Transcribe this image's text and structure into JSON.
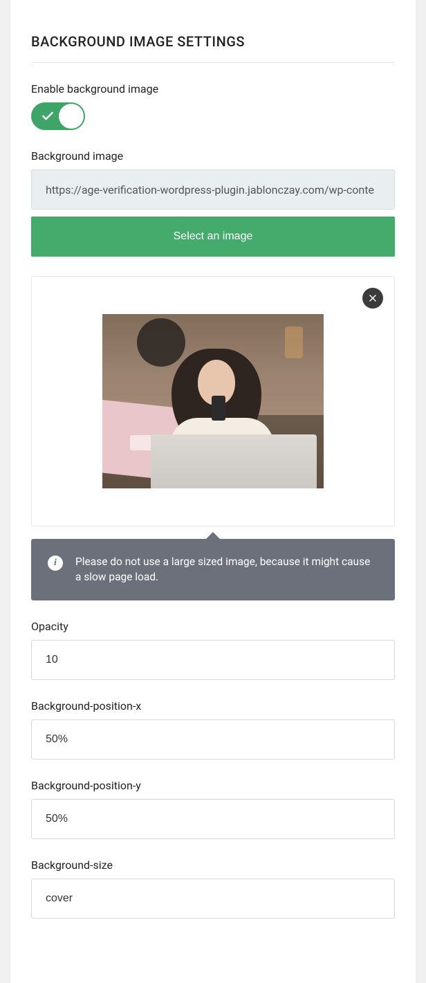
{
  "section_title": "BACKGROUND IMAGE SETTINGS",
  "enable": {
    "label": "Enable background image",
    "on": true
  },
  "bg_image": {
    "label": "Background image",
    "value": "https://age-verification-wordpress-plugin.jablonczay.com/wp-conte",
    "button": "Select an image"
  },
  "tooltip": "Please do not use a large sized image, because it might cause a slow page load.",
  "opacity": {
    "label": "Opacity",
    "value": "10"
  },
  "bpx": {
    "label": "Background-position-x",
    "value": "50%"
  },
  "bpy": {
    "label": "Background-position-y",
    "value": "50%"
  },
  "bsize": {
    "label": "Background-size",
    "value": "cover"
  }
}
